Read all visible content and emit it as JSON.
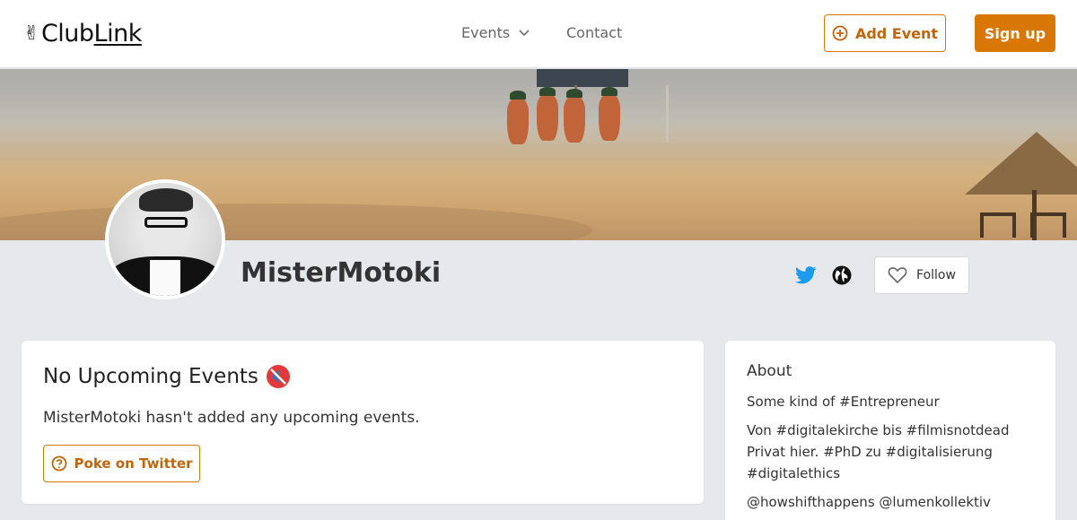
{
  "header": {
    "logo_hand": "✌",
    "logo_club": "Club",
    "logo_link": "Link",
    "nav_events": "Events",
    "nav_contact": "Contact",
    "add_event": "Add Event",
    "sign_up": "Sign up"
  },
  "colors": {
    "accent": "#d97706",
    "twitter": "#1d9bf0",
    "page_bg": "#e6e8ec"
  },
  "profile": {
    "name": "MisterMotoki",
    "follow": "Follow"
  },
  "events": {
    "title": "No Upcoming Events",
    "message": "MisterMotoki hasn't added any upcoming events.",
    "poke": "Poke on Twitter"
  },
  "about": {
    "title": "About",
    "line1": "Some kind of #Entrepreneur",
    "line2": "Von #digitalekirche bis #filmisnotdead Privat hier. #PhD zu #digitalisierung #digitalethics",
    "line3": "@howshifthappens @lumenkollektiv"
  }
}
